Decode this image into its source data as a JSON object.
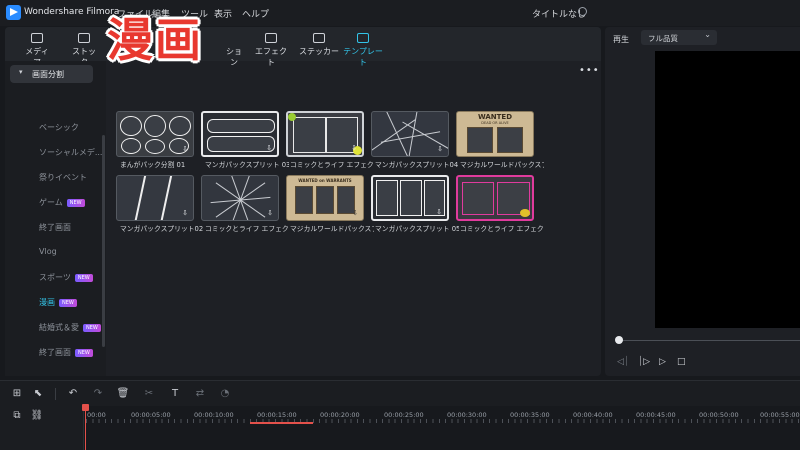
{
  "app": {
    "name": "Wondershare Filmora",
    "project_title": "タイトルなし"
  },
  "menu": [
    "ファイル",
    "編集",
    "ツール",
    "表示",
    "ヘルプ"
  ],
  "overlay_title": "漫画",
  "library_tabs": [
    {
      "label": "メディア",
      "icon": "media-icon"
    },
    {
      "label": "ストック",
      "icon": "stock-icon"
    },
    {
      "label": "ション",
      "icon": "transition-icon"
    },
    {
      "label": "エフェクト",
      "icon": "effect-icon"
    },
    {
      "label": "ステッカー",
      "icon": "sticker-icon"
    },
    {
      "label": "テンプレート",
      "icon": "template-icon",
      "active": true
    }
  ],
  "sidebar": {
    "header": "画面分割",
    "items": [
      {
        "label": "ベーシック"
      },
      {
        "label": "ソーシャルメデ..."
      },
      {
        "label": "祭りイベント"
      },
      {
        "label": "ゲーム",
        "badge": "NEW"
      },
      {
        "label": "終了画面"
      },
      {
        "label": "Vlog"
      },
      {
        "label": "スポーツ",
        "badge": "NEW"
      },
      {
        "label": "漫画",
        "badge": "NEW",
        "active": true
      },
      {
        "label": "結婚式＆愛",
        "badge": "NEW"
      },
      {
        "label": "終了画面",
        "badge": "NEW"
      }
    ]
  },
  "templates": [
    {
      "label": "まんがパック分割 01",
      "style": "circles"
    },
    {
      "label": "マンガパックスプリット 03",
      "style": "white"
    },
    {
      "label": "コミックとライフ エフェクト...",
      "style": "green"
    },
    {
      "label": "マンガパックスプリット04",
      "style": "rays"
    },
    {
      "label": "マジカルワールドパックスプ...",
      "style": "wanted"
    },
    {
      "label": "マンガパックスプリット02",
      "style": "diagonal"
    },
    {
      "label": "コミックとライフ エフェクト...",
      "style": "burst"
    },
    {
      "label": "マジカルワールドパックスプ...",
      "style": "warrants"
    },
    {
      "label": "マンガパックスプリット 05",
      "style": "white3"
    },
    {
      "label": "コミックとライフ エフェクト...",
      "style": "pink"
    }
  ],
  "wanted_text": "WANTED",
  "wanted_sub": "DEAD OR ALIVE",
  "warrants_text": "WANTED on WARRANTS",
  "player": {
    "label": "再生",
    "quality": "フル品質"
  },
  "timeline": {
    "ticks": [
      "00:00",
      "00:00:05:00",
      "00:00:10:00",
      "00:00:15:00",
      "00:00:20:00",
      "00:00:25:00",
      "00:00:30:00",
      "00:00:35:00",
      "00:00:40:00",
      "00:00:45:00",
      "00:00:50:00",
      "00:00:55:00"
    ]
  },
  "colors": {
    "accent": "#33c4e8",
    "playhead": "#e4514b",
    "overlay": "#e8382f"
  }
}
